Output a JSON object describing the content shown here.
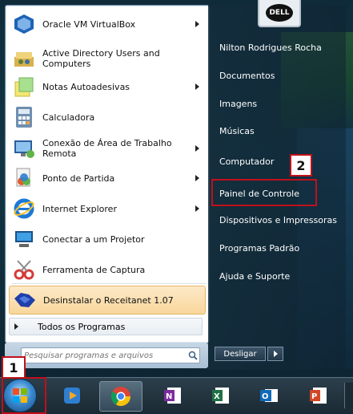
{
  "programs": [
    {
      "label": "Oracle VM VirtualBox",
      "icon": "virtualbox-icon",
      "arrow": true
    },
    {
      "label": "Active Directory Users and Computers",
      "icon": "ad-users-icon",
      "arrow": false
    },
    {
      "label": "Notas Autoadesivas",
      "icon": "sticky-notes-icon",
      "arrow": true
    },
    {
      "label": "Calculadora",
      "icon": "calculator-icon",
      "arrow": false
    },
    {
      "label": "Conexão de Área de Trabalho Remota",
      "icon": "remote-desktop-icon",
      "arrow": true
    },
    {
      "label": "Ponto de Partida",
      "icon": "getting-started-icon",
      "arrow": true
    },
    {
      "label": "Internet Explorer",
      "icon": "internet-explorer-icon",
      "arrow": true
    },
    {
      "label": "Conectar a um Projetor",
      "icon": "projector-icon",
      "arrow": false
    },
    {
      "label": "Ferramenta de Captura",
      "icon": "snipping-tool-icon",
      "arrow": false
    },
    {
      "label": "Desinstalar o Receitanet 1.07",
      "icon": "receitanet-icon",
      "arrow": false
    }
  ],
  "all_programs_label": "Todos os Programas",
  "search": {
    "placeholder": "Pesquisar programas e arquivos"
  },
  "right_items": [
    "Nilton Rodrigues Rocha",
    "Documentos",
    "Imagens",
    "Músicas",
    "Computador",
    "Painel de Controle",
    "Dispositivos e Impressoras",
    "Programas Padrão",
    "Ajuda e Suporte"
  ],
  "shutdown_label": "Desligar",
  "user_picture_logo": "DELL",
  "annotations": [
    "1",
    "2"
  ],
  "taskbar_apps": [
    "media-player-icon",
    "chrome-icon",
    "onenote-icon",
    "excel-icon",
    "outlook-icon",
    "powerpoint-icon"
  ],
  "colors": {
    "annotation": "#c0101a",
    "highlight": "#f9d79c"
  }
}
